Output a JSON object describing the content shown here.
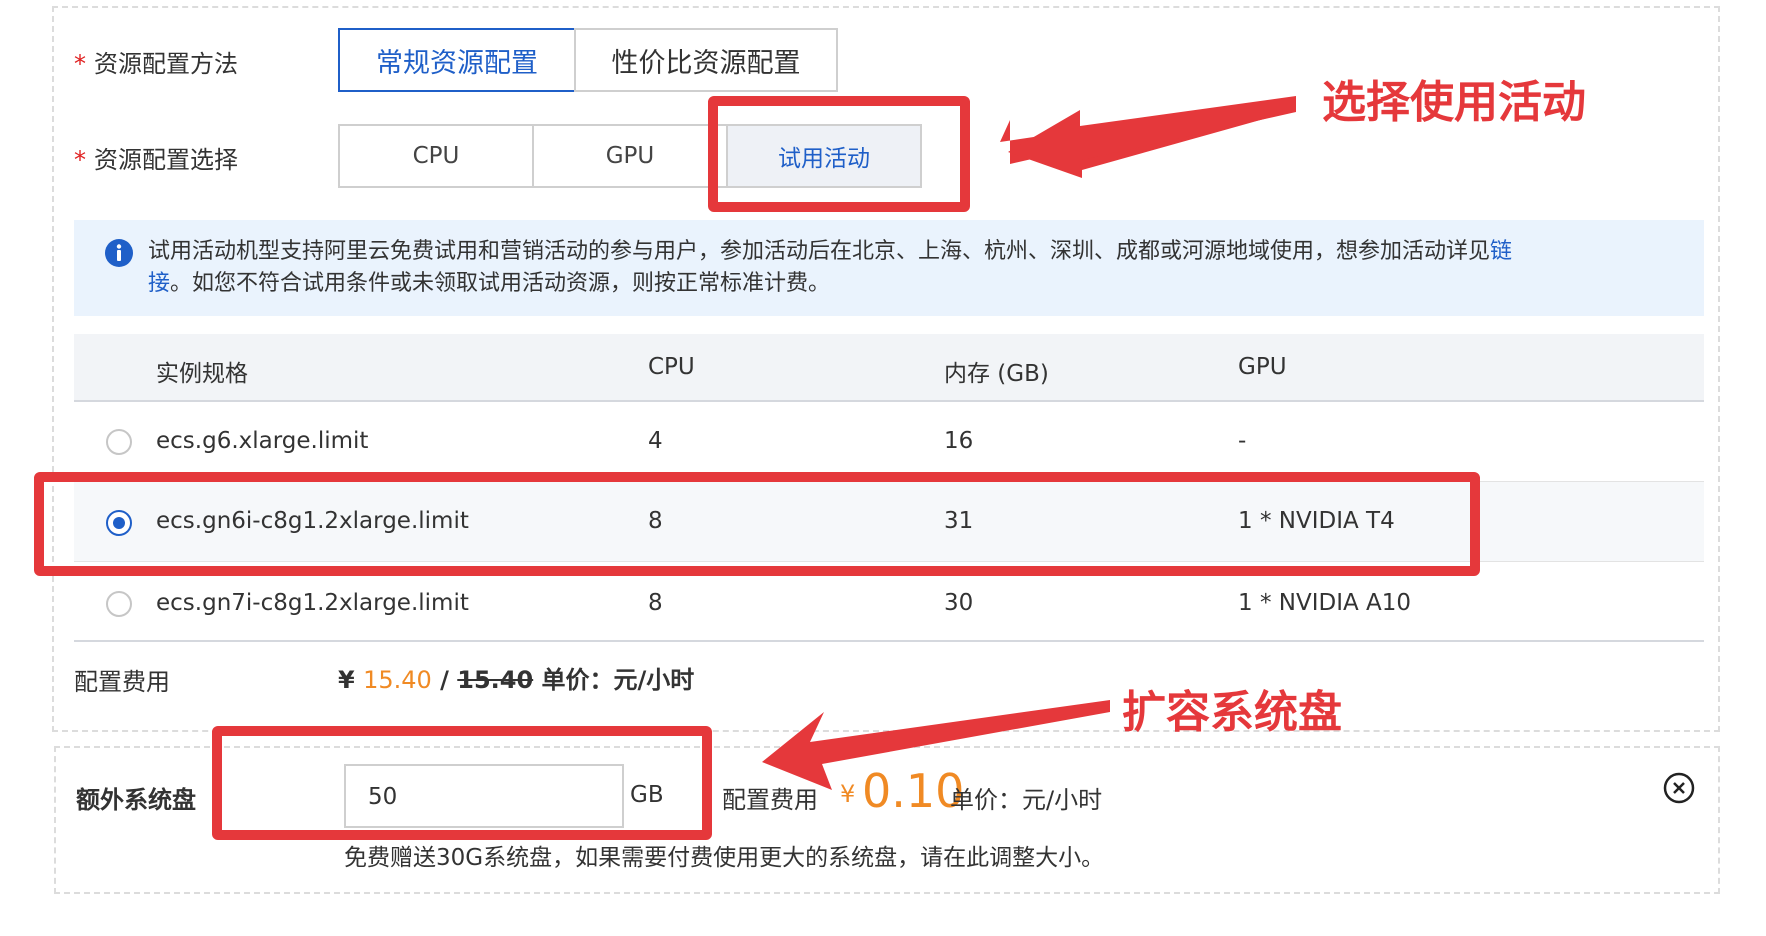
{
  "config_method": {
    "label": "资源配置方法",
    "options": [
      "常规资源配置",
      "性价比资源配置"
    ]
  },
  "config_select": {
    "label": "资源配置选择",
    "options": [
      "CPU",
      "GPU",
      "试用活动"
    ]
  },
  "notice": {
    "text": "试用活动机型支持阿里云免费试用和营销活动的参与用户，参加活动后在北京、上海、杭州、深圳、成都或河源地域使用，想参加活动详见",
    "link_part1": "链",
    "link_part2": "接",
    "text2": "。如您不符合试用条件或未领取试用活动资源，则按正常标准计费。"
  },
  "table": {
    "headers": [
      "实例规格",
      "CPU",
      "内存 (GB)",
      "GPU"
    ],
    "rows": [
      {
        "spec": "ecs.g6.xlarge.limit",
        "cpu": "4",
        "mem": "16",
        "gpu": "-"
      },
      {
        "spec": "ecs.gn6i-c8g1.2xlarge.limit",
        "cpu": "8",
        "mem": "31",
        "gpu": "1 * NVIDIA T4"
      },
      {
        "spec": "ecs.gn7i-c8g1.2xlarge.limit",
        "cpu": "8",
        "mem": "30",
        "gpu": "1 * NVIDIA A10"
      }
    ]
  },
  "cost": {
    "label": "配置费用",
    "currency": "¥",
    "price": "15.40",
    "sep": "/",
    "original": "15.40",
    "unit": "单价：元/小时"
  },
  "extra_disk": {
    "label": "额外系统盘",
    "value": "50",
    "unit": "GB",
    "cost_label": "配置费用",
    "currency": "¥",
    "price": "0.10",
    "price_unit": "单价：元/小时",
    "hint": "免费赠送30G系统盘，如果需要付费使用更大的系统盘，请在此调整大小。"
  },
  "annotations": {
    "select_activity": "选择使用活动",
    "expand_disk": "扩容系统盘"
  },
  "colors": {
    "accent": "#1f5fc8",
    "annotation": "#e5383b",
    "price": "#f08a24"
  }
}
